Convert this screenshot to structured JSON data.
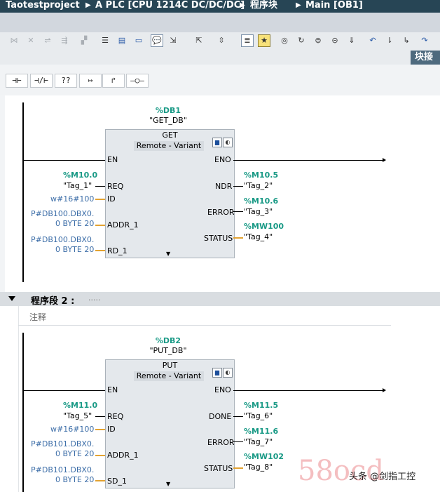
{
  "breadcrumb": {
    "project": "Taotestproject",
    "plc": "A PLC [CPU 1214C DC/DC/DC]",
    "folder": "程序块",
    "block": "Main [OB1]"
  },
  "side_panel_label": "块接",
  "palette": [
    "⊣⊢",
    "⊣/⊢",
    "??",
    "↦",
    "↱",
    "–○–"
  ],
  "networks": [
    {
      "db_address": "%DB1",
      "db_name": "\"GET_DB\"",
      "block_type": "GET",
      "block_variant": "Remote - Variant",
      "pins_left": [
        "EN",
        "REQ",
        "ID",
        "ADDR_1",
        "RD_1"
      ],
      "pins_right": [
        "ENO",
        "NDR",
        "ERROR",
        "STATUS"
      ],
      "req": {
        "address": "%M10.0",
        "symbol": "\"Tag_1\""
      },
      "id_value": "w#16#100",
      "addr1": [
        "P#DB100.DBX0.",
        "0 BYTE 20"
      ],
      "io1": [
        "P#DB100.DBX0.",
        "0 BYTE 20"
      ],
      "out1": {
        "address": "%M10.5",
        "symbol": "\"Tag_2\""
      },
      "out2": {
        "address": "%M10.6",
        "symbol": "\"Tag_3\""
      },
      "out3": {
        "address": "%MW100",
        "symbol": "\"Tag_4\""
      }
    },
    {
      "title": "程序段 2 :",
      "title_dots": ".....",
      "comment": "注释",
      "db_address": "%DB2",
      "db_name": "\"PUT_DB\"",
      "block_type": "PUT",
      "block_variant": "Remote - Variant",
      "pins_left": [
        "EN",
        "REQ",
        "ID",
        "ADDR_1",
        "SD_1"
      ],
      "pins_right": [
        "ENO",
        "DONE",
        "ERROR",
        "STATUS"
      ],
      "req": {
        "address": "%M11.0",
        "symbol": "\"Tag_5\""
      },
      "id_value": "w#16#100",
      "addr1": [
        "P#DB101.DBX0.",
        "0 BYTE 20"
      ],
      "io1": [
        "P#DB101.DBX0.",
        "0 BYTE 20"
      ],
      "out1": {
        "address": "%M11.5",
        "symbol": "\"Tag_6\""
      },
      "out2": {
        "address": "%M11.6",
        "symbol": "\"Tag_7\""
      },
      "out3": {
        "address": "%MW102",
        "symbol": "\"Tag_8\""
      }
    }
  ],
  "watermark": {
    "logo": "58ocd",
    "text": "头条 @剑指工控"
  }
}
